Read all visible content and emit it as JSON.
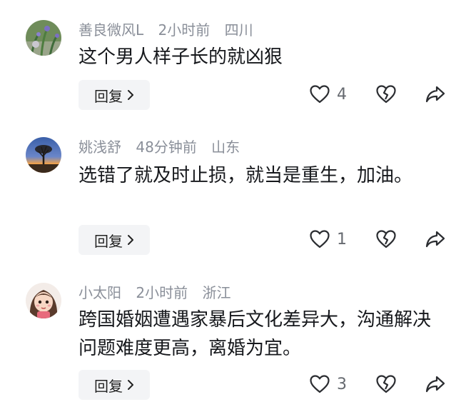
{
  "comments": [
    {
      "username": "善良微风L",
      "time": "2小时前",
      "location": "四川",
      "text": "这个男人样子长的就凶狠",
      "reply_label": "回复",
      "likes": "4",
      "avatar": "plant-photo-avatar"
    },
    {
      "username": "姚浅舒",
      "time": "48分钟前",
      "location": "山东",
      "text": "选错了就及时止损，就当是重生，加油。",
      "reply_label": "回复",
      "likes": "1",
      "avatar": "sunset-tree-avatar"
    },
    {
      "username": "小太阳",
      "time": "2小时前",
      "location": "浙江",
      "text": "跨国婚姻遭遇家暴后文化差异大，沟通解决问题难度更高，离婚为宜。",
      "reply_label": "回复",
      "likes": "3",
      "avatar": "cartoon-girl-avatar"
    }
  ],
  "icons": {
    "like": "heart-outline-icon",
    "dislike": "broken-heart-icon",
    "share": "share-arrow-icon"
  },
  "colors": {
    "meta_text": "#8a8f99",
    "body_text": "#16181c",
    "reply_bg": "#f3f4f6",
    "icon": "#2b2d31"
  }
}
